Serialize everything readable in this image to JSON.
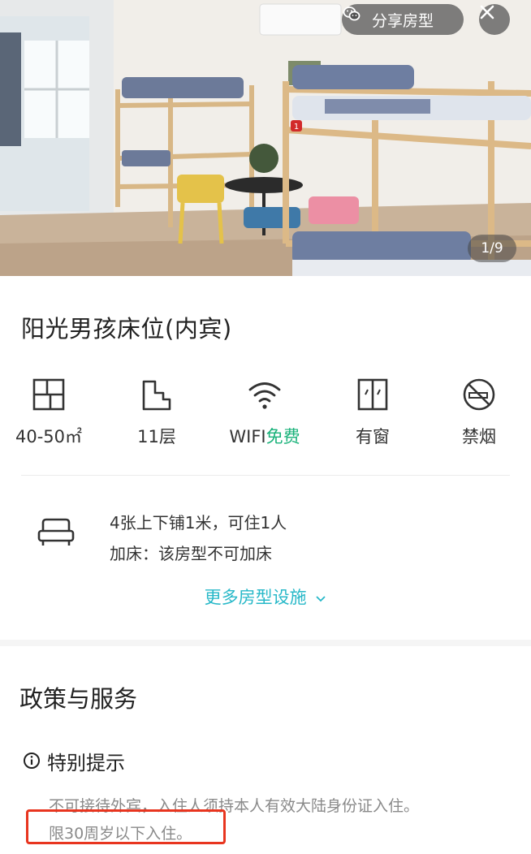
{
  "header": {
    "share_label": "分享房型",
    "photo_counter": "1/9",
    "bunk_badge": "1"
  },
  "room": {
    "title": "阳光男孩床位(内宾)"
  },
  "facilities": [
    {
      "icon": "floorplan-icon",
      "label": "40-50㎡"
    },
    {
      "icon": "floor-stairs-icon",
      "label": "11层"
    },
    {
      "icon": "wifi-icon",
      "label": "WIFI",
      "label_highlight": "免费"
    },
    {
      "icon": "window-icon",
      "label": "有窗"
    },
    {
      "icon": "no-smoking-icon",
      "label": "禁烟"
    }
  ],
  "bed": {
    "icon": "sofa-bed-icon",
    "line1": "4张上下铺1米，可住1人",
    "line2": "加床：该房型不可加床"
  },
  "more_facilities_label": "更多房型设施",
  "policy": {
    "title": "政策与服务",
    "tip_title": "特别提示",
    "tip_line1": "不可接待外宾，入住人须持本人有效大陆身份证入住。",
    "tip_line2": "限30周岁以下入住。"
  },
  "colors": {
    "free_green": "#19b27a",
    "link_teal": "#27b8c8",
    "highlight_red": "#e8351f"
  }
}
